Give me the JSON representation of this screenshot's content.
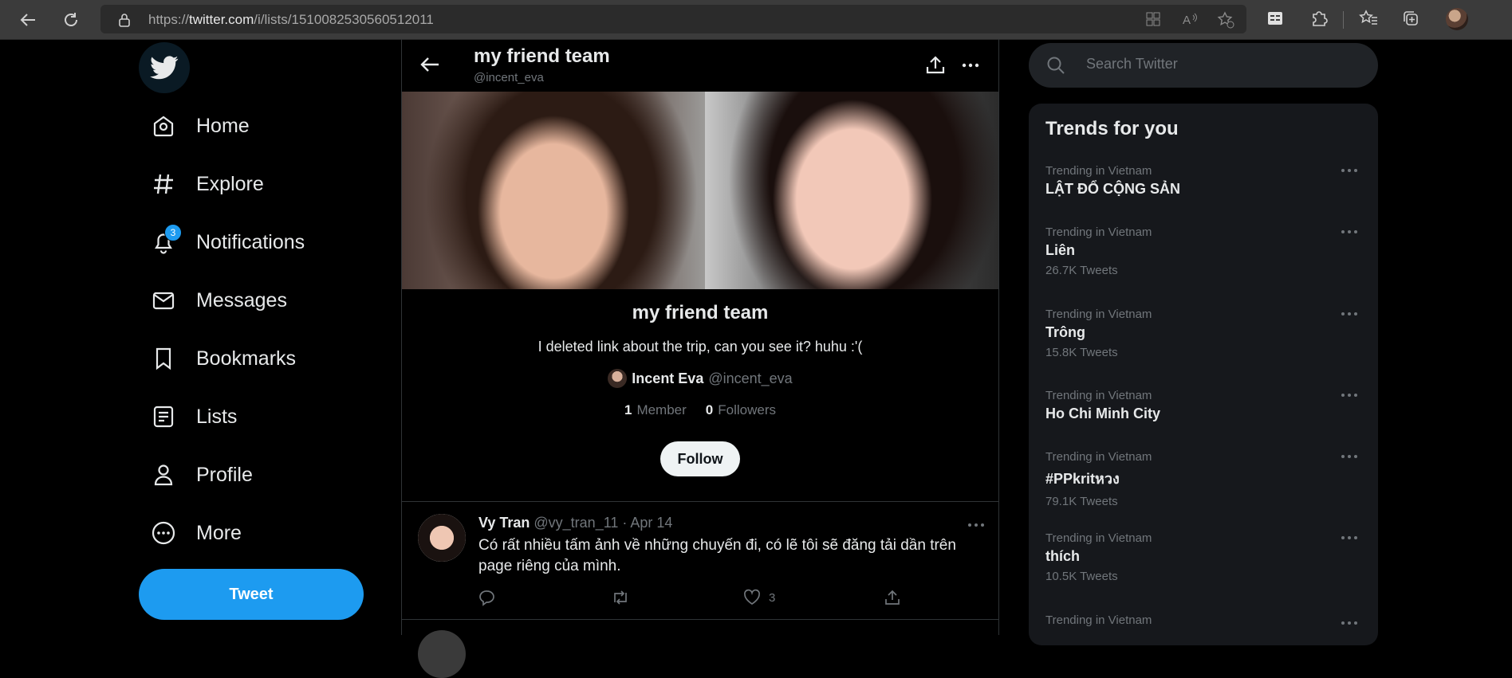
{
  "browser": {
    "url_prefix": "https://",
    "url_domain": "twitter.com",
    "url_path": "/i/lists/1510082530560512011"
  },
  "nav": {
    "items": [
      {
        "label": "Home"
      },
      {
        "label": "Explore"
      },
      {
        "label": "Notifications",
        "badge": "3"
      },
      {
        "label": "Messages"
      },
      {
        "label": "Bookmarks"
      },
      {
        "label": "Lists"
      },
      {
        "label": "Profile"
      },
      {
        "label": "More"
      }
    ],
    "tweet_label": "Tweet"
  },
  "header": {
    "title": "my friend team",
    "handle": "@incent_eva"
  },
  "list": {
    "name": "my friend team",
    "description": "I deleted link about the trip, can you see it? huhu :'(",
    "owner_name": "Incent Eva",
    "owner_handle": "@incent_eva",
    "members_count": "1",
    "members_label": "Member",
    "followers_count": "0",
    "followers_label": "Followers",
    "follow_label": "Follow"
  },
  "tweet": {
    "author": "Vy Tran",
    "meta": "@vy_tran_11 · Apr 14",
    "text": "Có rất nhiều tấm ảnh về những chuyến đi, có lẽ tôi sẽ đăng tải dần trên page riêng của mình.",
    "likes": "3"
  },
  "search": {
    "placeholder": "Search Twitter"
  },
  "trends": {
    "title": "Trends for you",
    "items": [
      {
        "context": "Trending in Vietnam",
        "name": "LẬT ĐỔ CỘNG SẢN",
        "count": ""
      },
      {
        "context": "Trending in Vietnam",
        "name": "Liên",
        "count": "26.7K Tweets"
      },
      {
        "context": "Trending in Vietnam",
        "name": "Trông",
        "count": "15.8K Tweets"
      },
      {
        "context": "Trending in Vietnam",
        "name": "Ho Chi Minh City",
        "count": ""
      },
      {
        "context": "Trending in Vietnam",
        "name": "#PPkritหวง",
        "count": "79.1K Tweets"
      },
      {
        "context": "Trending in Vietnam",
        "name": "thích",
        "count": "10.5K Tweets"
      },
      {
        "context": "Trending in Vietnam",
        "name": "",
        "count": ""
      }
    ]
  },
  "colors": {
    "accent": "#1d9bf0",
    "background": "#000000",
    "text_primary": "#e7e9ea",
    "text_secondary": "#71767b"
  }
}
